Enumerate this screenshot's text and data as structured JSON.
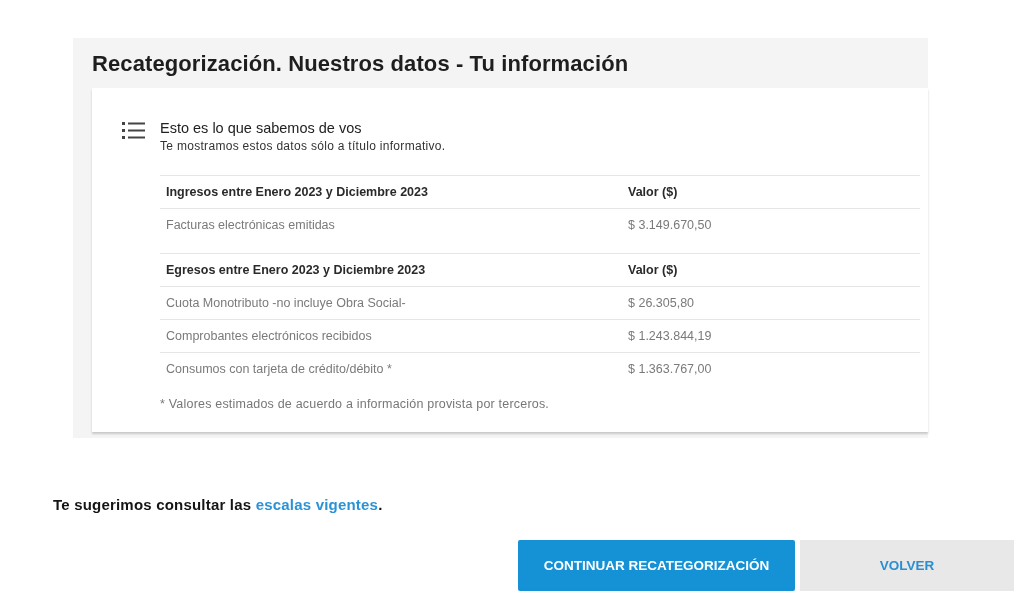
{
  "card": {
    "title": "Recategorización. Nuestros datos - Tu información",
    "info": {
      "heading": "Esto es lo que sabemos de vos",
      "subheading": "Te mostramos estos datos sólo a título informativo."
    },
    "sections": [
      {
        "columns": [
          "Ingresos entre Enero 2023 y Diciembre 2023",
          "Valor ($)"
        ],
        "rows": [
          [
            "Facturas electrónicas emitidas",
            "$ 3.149.670,50"
          ]
        ]
      },
      {
        "columns": [
          "Egresos entre Enero 2023 y Diciembre 2023",
          "Valor ($)"
        ],
        "rows": [
          [
            "Cuota Monotributo -no incluye Obra Social-",
            "$ 26.305,80"
          ],
          [
            "Comprobantes electrónicos recibidos",
            "$ 1.243.844,19"
          ],
          [
            "Consumos con tarjeta de crédito/débito *",
            "$ 1.363.767,00"
          ]
        ]
      }
    ],
    "footnote": "* Valores estimados de acuerdo a información provista por terceros."
  },
  "suggestion": {
    "text": "Te sugerimos consultar las",
    "link": "escalas vigentes",
    "end": "."
  },
  "buttons": [
    {
      "label": "CONTINUAR RECATEGORIZACIÓN",
      "kind": "primary"
    },
    {
      "label": "VOLVER",
      "kind": "secondary"
    }
  ]
}
